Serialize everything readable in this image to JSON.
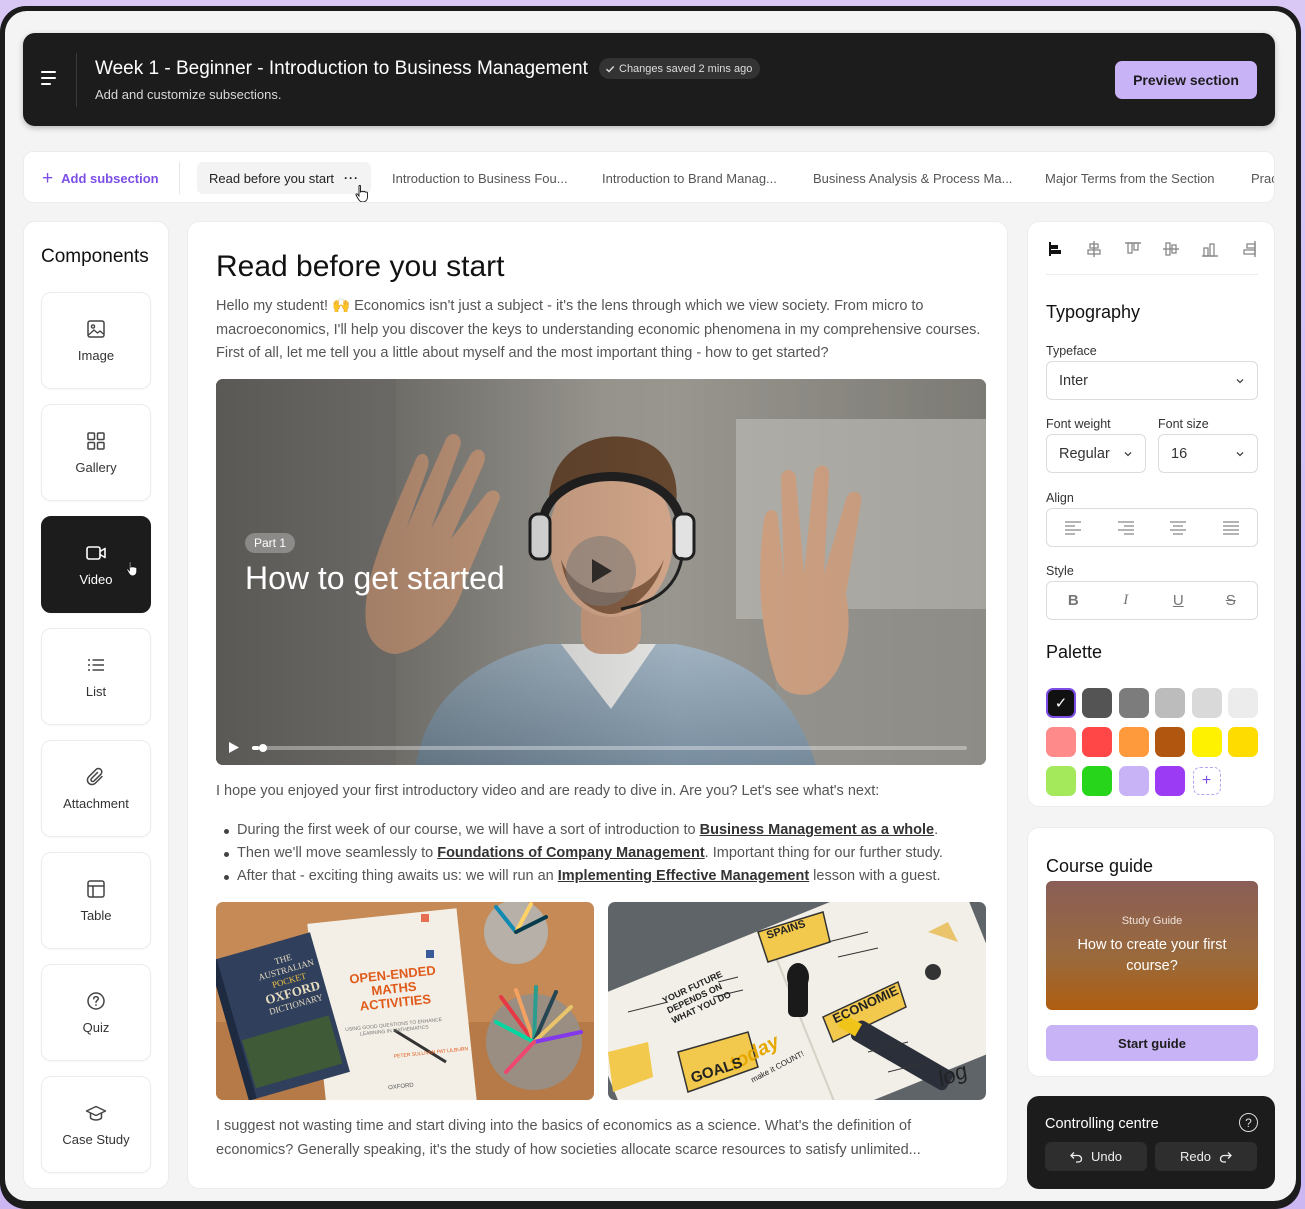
{
  "header": {
    "title": "Week 1 - Beginner - Introduction to Business Management",
    "saved_status": "Changes saved 2 mins ago",
    "subtitle": "Add and customize subsections.",
    "preview_label": "Preview section"
  },
  "tabs": {
    "add_label": "Add subsection",
    "items": [
      {
        "label": "Read before you start",
        "active": true
      },
      {
        "label": "Introduction to Business Fou..."
      },
      {
        "label": "Introduction to Brand Manag..."
      },
      {
        "label": "Business Analysis & Process Ma..."
      },
      {
        "label": "Major Terms from the Section"
      },
      {
        "label": "Prac"
      }
    ]
  },
  "components": {
    "title": "Components",
    "items": [
      {
        "label": "Image",
        "icon": "image-icon"
      },
      {
        "label": "Gallery",
        "icon": "gallery-icon"
      },
      {
        "label": "Video",
        "icon": "video-icon",
        "active": true
      },
      {
        "label": "List",
        "icon": "list-icon"
      },
      {
        "label": "Attachment",
        "icon": "paperclip-icon"
      },
      {
        "label": "Table",
        "icon": "table-icon"
      },
      {
        "label": "Quiz",
        "icon": "question-icon"
      },
      {
        "label": "Case Study",
        "icon": "graduation-cap-icon"
      }
    ]
  },
  "content": {
    "heading": "Read before you start",
    "intro": "Hello my student! 🙌 Economics isn't just a subject - it's the lens through which we view society. From micro to macroeconomics, I'll help you discover the keys to understanding economic phenomena in my comprehensive courses. First of all, let me tell you a little about myself and the most important thing - how to get started?",
    "video": {
      "badge": "Part 1",
      "title": "How to get started",
      "progress": 0.01
    },
    "after_video": "I hope you enjoyed your first introductory video and are ready to dive in. Are you? Let's see what's next:",
    "bullets": [
      {
        "before": "During the first week of our course, we will have a sort of introduction to ",
        "link": "Business Management as a whole",
        "after": "."
      },
      {
        "before": "Then we'll move seamlessly to ",
        "link": "Foundations of Company Management",
        "after": ". Important thing for our further study."
      },
      {
        "before": "After that - exciting thing awaits us: we will run an ",
        "link": "Implementing Effective Management",
        "after": " lesson with a guest."
      }
    ],
    "image1": {
      "line1": "THE AUSTRALIAN",
      "line2": "POCKET",
      "line3": "OXFORD",
      "line4": "DICTIONARY",
      "book_title": "OPEN-ENDED MATHS ACTIVITIES",
      "book_sub": "USING GOOD QUESTIONS TO ENHANCE LEARNING IN MATHEMATICS",
      "book_author": "PETER SULLIVAN PAT LILBURN",
      "book_publisher": "OXFORD"
    },
    "image2": {
      "word1": "SPAINS",
      "word2": "YOUR FUTURE DEPENDS ON WHAT YOU DO",
      "word3": "today",
      "word4": "make it COUNT!",
      "word5": "ECONOMIE",
      "word6": "GOALS",
      "word7": "log"
    },
    "closing": "I suggest not wasting time and start diving into the basics of economics as a science. What's the definition of economics? Generally speaking, it's the study of how societies allocate scarce resources to satisfy unlimited..."
  },
  "typography": {
    "title": "Typography",
    "typeface_label": "Typeface",
    "typeface_value": "Inter",
    "weight_label": "Font weight",
    "weight_value": "Regular",
    "size_label": "Font size",
    "size_value": "16",
    "align_label": "Align",
    "style_label": "Style",
    "style_buttons": [
      "B",
      "I",
      "U",
      "S"
    ]
  },
  "palette": {
    "title": "Palette",
    "colors": [
      "#000000",
      "#545454",
      "#7c7c7c",
      "#bcbcbc",
      "#d9d9d9",
      "#ececec",
      "#ff8a8a",
      "#ff4747",
      "#ff9a3c",
      "#b0560e",
      "#fff200",
      "#ffdc00",
      "#a4e85c",
      "#27d61a",
      "#c8b3f7",
      "#9b3cf4"
    ]
  },
  "guide": {
    "title": "Course guide",
    "small": "Study Guide",
    "big": "How to create your first course?",
    "button": "Start guide"
  },
  "control": {
    "title": "Controlling centre",
    "help": "?",
    "undo": "Undo",
    "redo": "Redo"
  }
}
